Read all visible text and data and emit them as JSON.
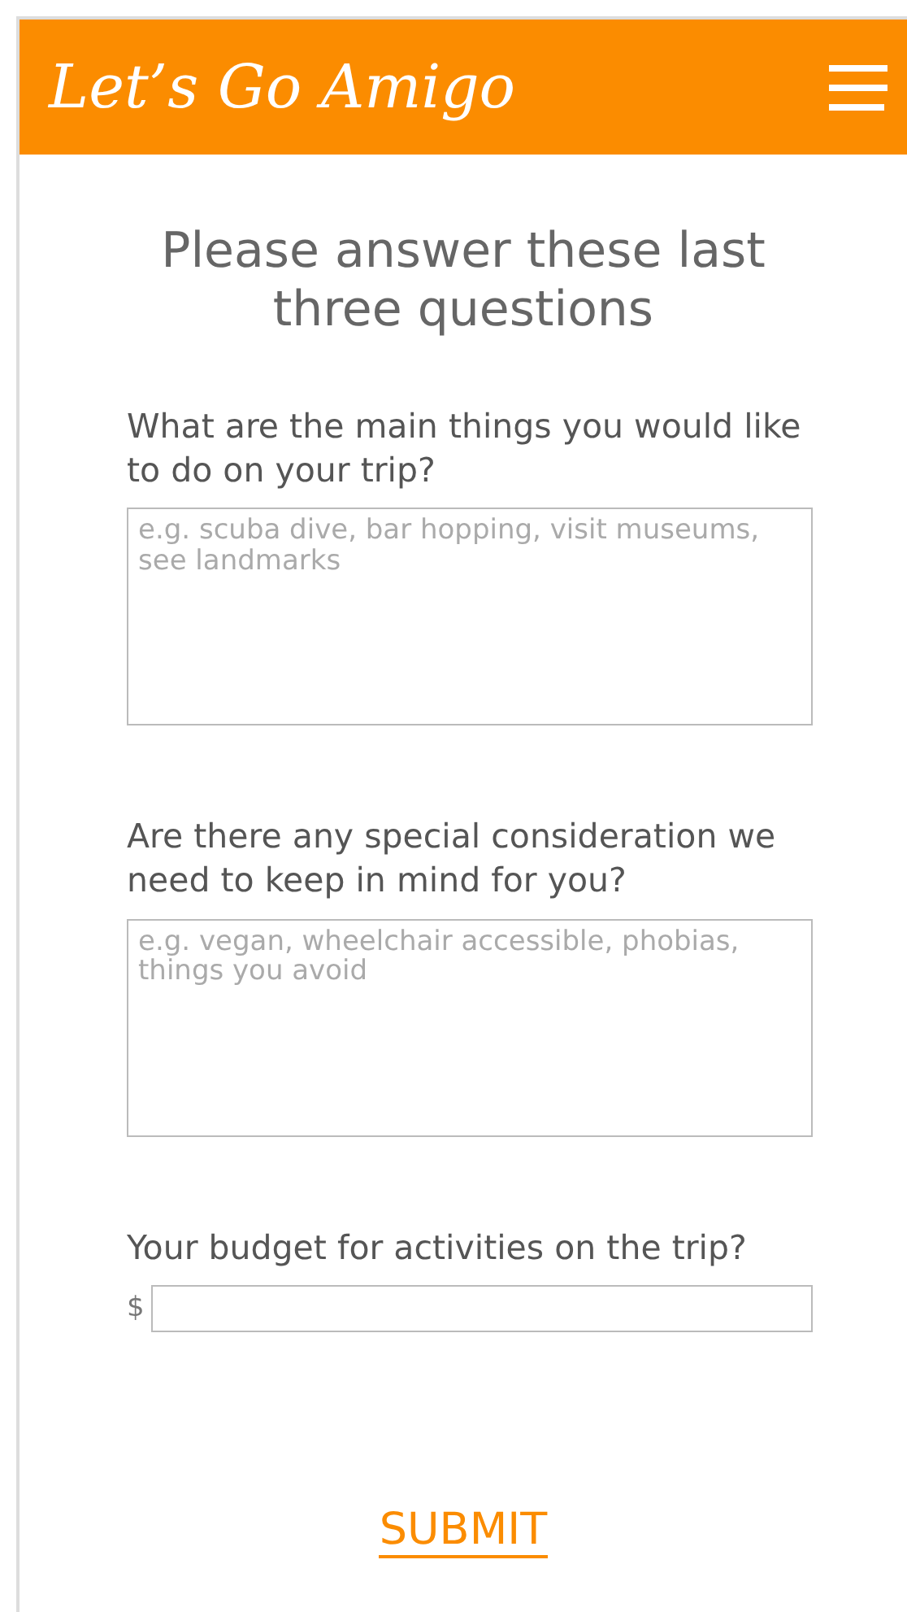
{
  "header": {
    "title": "Let’s Go Amigo"
  },
  "heading": "Please answer these last three questions",
  "questions": [
    {
      "kind": "textarea",
      "label": "What are the main things you would like to do on your trip?",
      "placeholder": "e.g. scuba dive, bar hopping, visit museums, see landmarks"
    },
    {
      "kind": "textarea",
      "label": "Are there any special consideration we need to keep in mind for you?",
      "placeholder": "e.g. vegan, wheelchair accessible, phobias, things you avoid"
    },
    {
      "kind": "money",
      "label": "Your budget for activities on the trip?",
      "prefix": "$"
    }
  ],
  "submit": "SUBMIT"
}
